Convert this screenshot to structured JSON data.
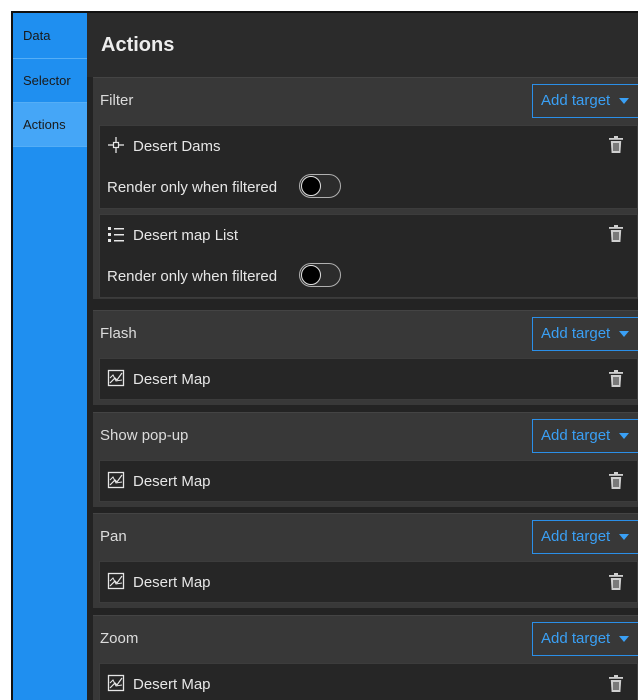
{
  "sidebar": {
    "tabs": [
      {
        "label": "Data"
      },
      {
        "label": "Selector"
      },
      {
        "label": "Actions"
      }
    ]
  },
  "page": {
    "title": "Actions"
  },
  "add_target_label": "Add target",
  "render_only_label": "Render only when filtered",
  "sections": {
    "filter": {
      "label": "Filter",
      "targets": [
        {
          "label": "Desert Dams",
          "icon": "point-layer-icon",
          "render_only": false
        },
        {
          "label": "Desert map List",
          "icon": "list-icon",
          "render_only": false
        }
      ]
    },
    "flash": {
      "label": "Flash",
      "targets": [
        {
          "label": "Desert Map",
          "icon": "map-icon"
        }
      ]
    },
    "popup": {
      "label": "Show pop-up",
      "targets": [
        {
          "label": "Desert Map",
          "icon": "map-icon"
        }
      ]
    },
    "pan": {
      "label": "Pan",
      "targets": [
        {
          "label": "Desert Map",
          "icon": "map-icon"
        }
      ]
    },
    "zoom": {
      "label": "Zoom",
      "targets": [
        {
          "label": "Desert Map",
          "icon": "map-icon"
        }
      ]
    }
  },
  "colors": {
    "sidebar": "#1f8ff0",
    "sidebar_active": "#45a6f7",
    "accent": "#3aa0f5",
    "panel_bg": "#232323"
  }
}
